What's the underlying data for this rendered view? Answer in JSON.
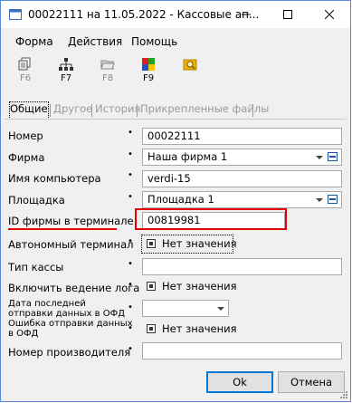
{
  "window": {
    "title": "00022111 на 11.05.2022 - Кассовые ап...",
    "controls": [
      "minimize",
      "maximize",
      "close"
    ]
  },
  "menu": [
    "Форма",
    "Действия",
    "Помощь"
  ],
  "toolbar": [
    {
      "icon": "copy-icon",
      "label": "F6"
    },
    {
      "icon": "hierarchy-icon",
      "label": "F7"
    },
    {
      "icon": "folder-icon",
      "label": "F8"
    },
    {
      "icon": "color-grid-icon",
      "label": "F9"
    },
    {
      "icon": "search-folder-icon",
      "label": ""
    }
  ],
  "tabs": [
    "Общие",
    "Другое",
    "История",
    "Прикрепленные файлы"
  ],
  "form": {
    "number": {
      "label": "Номер",
      "value": "00022111"
    },
    "firm": {
      "label": "Фирма",
      "value": "Наша фирма 1"
    },
    "computer": {
      "label": "Имя компьютера",
      "value": "verdi-15"
    },
    "site": {
      "label": "Площадка",
      "value": "Площадка 1"
    },
    "firm_id": {
      "label": "ID фирмы в терминале",
      "value": "00819981"
    },
    "autonomous": {
      "label": "Автономный терминал",
      "value": "Нет значения"
    },
    "kkm_type": {
      "label": "Тип кассы",
      "value": ""
    },
    "logging": {
      "label": "Включить ведение лога",
      "value": "Нет значения"
    },
    "last_ofd": {
      "label": "Дата последней отправки данных в ОФД",
      "value": ""
    },
    "ofd_error": {
      "label": "Ошибка отправки данных в ОФД",
      "value": "Нет значения"
    },
    "manufacturer_no": {
      "label": "Номер производителя",
      "value": ""
    }
  },
  "buttons": {
    "ok": "Ok",
    "cancel": "Отмена"
  },
  "colors": {
    "highlight": "#e60000",
    "accent": "#0078d7"
  }
}
